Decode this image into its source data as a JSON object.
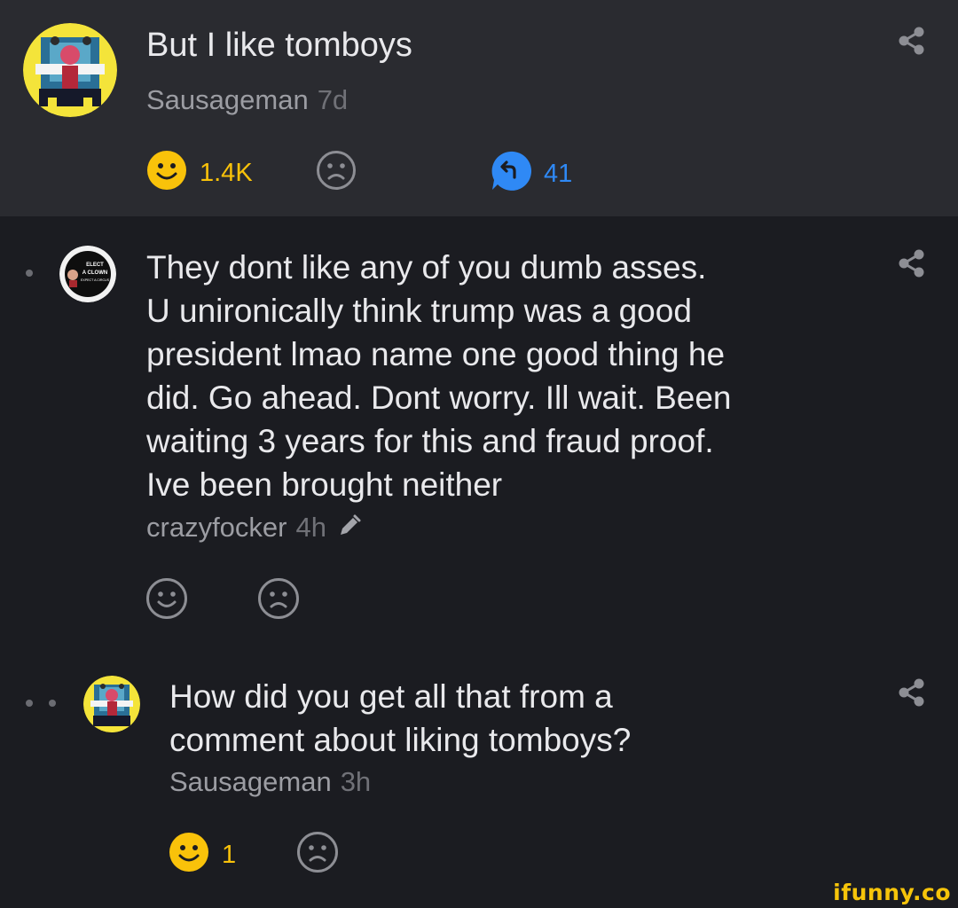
{
  "post": {
    "title": "But I like tomboys",
    "author": "Sausageman",
    "time": "7d",
    "smile_count": "1.4K",
    "reply_count": "41",
    "colors": {
      "smile": "#f9c20a",
      "reply": "#2f89f5",
      "muted_icon": "#8d8e94"
    }
  },
  "comments": [
    {
      "text_lines": [
        "They dont like any of you dumb asses.",
        "U unironically think trump was a good",
        "president lmao name one good thing he",
        "did. Go ahead. Dont worry. Ill wait. Been",
        "waiting 3 years for this and fraud proof.",
        "Ive been brought neither"
      ],
      "author": "crazyfocker",
      "time": "4h",
      "avatar_text": [
        "ELECT",
        "A CLOWN",
        "EXPECT A CIRCUS"
      ]
    },
    {
      "text_lines": [
        "How did you get all that from a",
        "comment about liking tomboys?"
      ],
      "author": "Sausageman",
      "time": "3h",
      "smile_count": "1"
    }
  ],
  "watermark": "ifunny.co"
}
